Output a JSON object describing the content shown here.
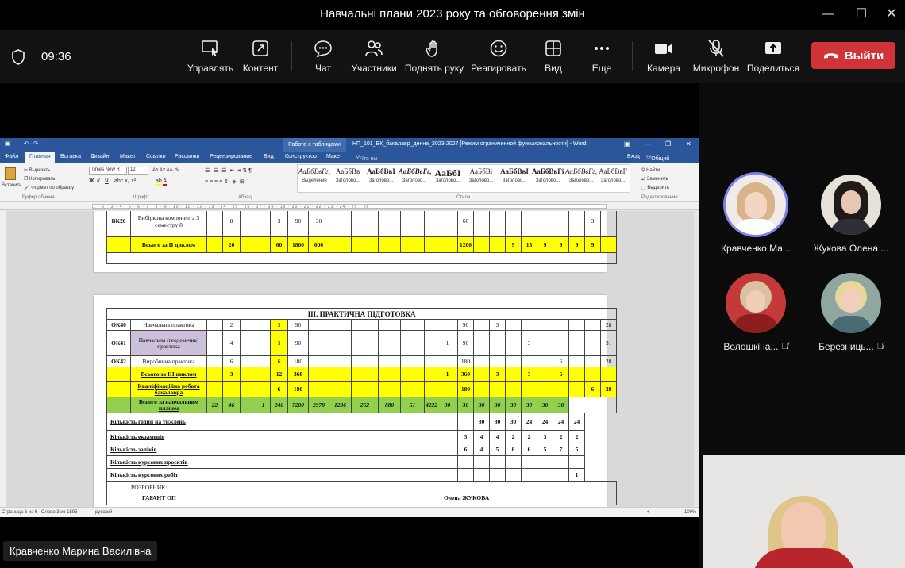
{
  "window": {
    "title": "Навчальні плани 2023 року та обговорення змін",
    "controls": [
      "—",
      "☐",
      "✕"
    ]
  },
  "meeting": {
    "clock": "09:36",
    "toolbar": [
      {
        "label": "Управлять",
        "icon": "share-control-icon"
      },
      {
        "label": "Контент",
        "icon": "share-content-icon"
      },
      {
        "label": "Чат",
        "icon": "chat-icon"
      },
      {
        "label": "Участники",
        "icon": "people-icon"
      },
      {
        "label": "Поднять руку",
        "icon": "raise-hand-icon"
      },
      {
        "label": "Реагировать",
        "icon": "react-icon"
      },
      {
        "label": "Вид",
        "icon": "view-icon"
      },
      {
        "label": "Еще",
        "icon": "more-icon"
      },
      {
        "label": "Камера",
        "icon": "camera-icon"
      },
      {
        "label": "Микрофон",
        "icon": "mic-off-icon"
      },
      {
        "label": "Поделиться",
        "icon": "share-icon"
      }
    ],
    "leave_label": "Выйти",
    "accent": "#d13438"
  },
  "participants": [
    {
      "name": "Кравченко Ма...",
      "muted": false,
      "speaking": true
    },
    {
      "name": "Жукова Олена ...",
      "muted": false,
      "speaking": false
    },
    {
      "name": "Волошкіна...",
      "muted": true,
      "speaking": false
    },
    {
      "name": "Березниць...",
      "muted": true,
      "speaking": false
    }
  ],
  "presenter_name": "Кравченко Марина Василівна",
  "word": {
    "context_tab": "Работа с таблицами",
    "doc_title": "НП_101_ЕК_бакалавр_денна_2023-2027 [Режим ограниченной функциональности] - Word",
    "sign_in": "Вход",
    "share": "Общий доступ",
    "tabs": [
      "Файл",
      "Главная",
      "Вставка",
      "Дизайн",
      "Макет",
      "Ссылки",
      "Рассылки",
      "Рецензирование",
      "Вид",
      "Конструктор",
      "Макет"
    ],
    "tell_me": "Что вы хотите сделать?",
    "clipboard": {
      "paste": "Вставить",
      "cut": "Вырезать",
      "copy": "Копировать",
      "format": "Формат по образцу",
      "group": "Буфер обмена"
    },
    "font": {
      "name": "Times New R",
      "size": "12",
      "group": "Шрифт"
    },
    "paragraph_group": "Абзац",
    "styles_group": "Стили",
    "styles": [
      {
        "sample": "АаБбВвГг,",
        "label": "Выделение"
      },
      {
        "sample": "АаБбВв",
        "label": "Заголово..."
      },
      {
        "sample": "АаБбВвІ",
        "label": "Заголово..."
      },
      {
        "sample": "АаБбВеГг,",
        "label": "Заголово..."
      },
      {
        "sample": "АаБбІ",
        "label": "Заголово..."
      },
      {
        "sample": "АаБбВі",
        "label": "Заголово..."
      },
      {
        "sample": "АаБбВвІ",
        "label": "Заголово..."
      },
      {
        "sample": "АаБбВвГі",
        "label": "Заголово..."
      },
      {
        "sample": "АаБбВвГг,",
        "label": "Заголово..."
      },
      {
        "sample": "АаБбВвГ",
        "label": "Заголово..."
      }
    ],
    "editing": {
      "find": "Найти",
      "replace": "Заменить",
      "select": "Выделить",
      "group": "Редактирование"
    },
    "status": {
      "page": "Страница 6 из 6",
      "words": "Слово 3 из 1595",
      "lang": "русский",
      "zoom": "100%"
    },
    "ruler_text": "1 · 2 · 3 · 4 · 5 · 6 · 7 · 8 · 9 · 10 · 11 · 12 · 13 · 14 · 15 · 16 · 17 · 18 · 19 · 20 · 21 · 22 · 23 · 24 · 25 · 26"
  },
  "table_top": {
    "rows": [
      {
        "code": "ВК20",
        "name": "Вибіркова компонента 3 семестру 8",
        "cells": [
          "",
          "8",
          "",
          "",
          "3",
          "90",
          "30",
          "",
          "",
          "",
          "",
          "",
          "",
          "60",
          "",
          "",
          "",
          "",
          "",
          "",
          "",
          "3",
          ""
        ]
      },
      {
        "code": "",
        "name": "Всього за ІІ циклом",
        "cells": [
          "",
          "20",
          "",
          "",
          "60",
          "1800",
          "600",
          "",
          "",
          "",
          "",
          "",
          "",
          "1200",
          "",
          "",
          "9",
          "15",
          "9",
          "9",
          "9",
          "9",
          ""
        ]
      }
    ]
  },
  "table_main": {
    "section_title": "ІІІ. ПРАКТИЧНА ПІДГОТОВКА",
    "rows": [
      {
        "code": "ОК40",
        "name": "Навчальна практика",
        "cells": [
          "",
          "2",
          "",
          "",
          "3",
          "90",
          "",
          "",
          "",
          "",
          "",
          "",
          "",
          "90",
          "",
          "3",
          "",
          "",
          "",
          "",
          "",
          "",
          "28"
        ]
      },
      {
        "code": "ОК41",
        "name": "Навчальна (геодезична) практика",
        "cells": [
          "",
          "4",
          "",
          "",
          "3",
          "90",
          "",
          "",
          "",
          "",
          "",
          "",
          "1",
          "90",
          "",
          "",
          "",
          "3",
          "",
          "",
          "",
          "",
          "31"
        ]
      },
      {
        "code": "ОК42",
        "name": "Виробнича практика",
        "cells": [
          "",
          "6",
          "",
          "",
          "6",
          "180",
          "",
          "",
          "",
          "",
          "",
          "",
          "",
          "180",
          "",
          "",
          "",
          "",
          "",
          "6",
          "",
          "",
          "28"
        ]
      },
      {
        "code": "",
        "name": "Всього за ІІІ циклом",
        "cells": [
          "",
          "3",
          "",
          "",
          "12",
          "360",
          "",
          "",
          "",
          "",
          "",
          "",
          "1",
          "360",
          "",
          "3",
          "",
          "3",
          "",
          "6",
          "",
          "",
          ""
        ]
      },
      {
        "code": "",
        "name": "Кваліфікаційна робота бакалавра",
        "cells": [
          "",
          "",
          "",
          "",
          "6",
          "180",
          "",
          "",
          "",
          "",
          "",
          "",
          "",
          "180",
          "",
          "",
          "",
          "",
          "",
          "",
          "",
          "6",
          "28"
        ]
      },
      {
        "code": "",
        "name": "Всього за навчальним планом",
        "cells": [
          "22",
          "46",
          "",
          "1",
          "240",
          "7200",
          "2978",
          "1236",
          "262",
          "880",
          "51",
          "4222",
          "30",
          "30",
          "30",
          "30",
          "30",
          "30",
          "30",
          "30"
        ]
      }
    ],
    "summary": [
      {
        "label": "Кількість годин на тиждень",
        "values": [
          "30",
          "30",
          "30",
          "24",
          "24",
          "24",
          "24"
        ]
      },
      {
        "label": "Кількість екзаменів",
        "values": [
          "3",
          "4",
          "4",
          "2",
          "2",
          "3",
          "2",
          "2"
        ]
      },
      {
        "label": "Кількість заліків",
        "values": [
          "6",
          "4",
          "5",
          "8",
          "6",
          "5",
          "7",
          "5"
        ]
      },
      {
        "label": "Кількість курсових проєктів",
        "values": [
          "",
          "",
          "",
          "",
          "",
          "",
          "",
          ""
        ]
      },
      {
        "label": "Кількість курсових робіт",
        "values": [
          "",
          "",
          "",
          "",
          "",
          "",
          "",
          "1"
        ]
      }
    ],
    "footer": {
      "developer": "РОЗРОБНИК:",
      "guarantor": "ГАРАНТ ОП",
      "signature_first": "Олена",
      "signature_last": "ЖУКОВА"
    }
  }
}
